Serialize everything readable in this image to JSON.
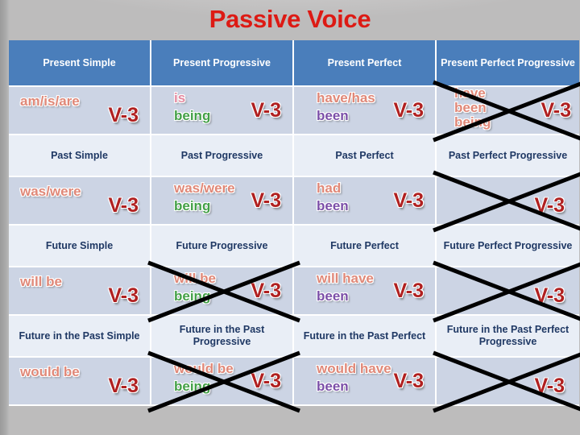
{
  "slide": {
    "title": "Passive Voice",
    "title_color": "#dd1a14",
    "header_bg": "#4a7ebb",
    "formula_row_bg": "#ccd4e4",
    "label_row_bg": "#e9eef6",
    "label_text_color": "#1f3864",
    "v3_color": "#b02020",
    "aux_salmon": "#e08878",
    "aux_pink": "#e58aa0",
    "aux_green": "#43a047",
    "aux_purple": "#7b4fa8"
  },
  "headers": [
    {
      "label": "Present Simple"
    },
    {
      "label": "Present Progressive"
    },
    {
      "label": "Present Perfect"
    },
    {
      "label": "Present Perfect Progressive"
    }
  ],
  "labels": {
    "past": [
      "Past Simple",
      "Past Progressive",
      "Past Perfect",
      "Past Perfect Progressive"
    ],
    "future": [
      "Future Simple",
      "Future Progressive",
      "Future Perfect",
      "Future Perfect Progressive"
    ],
    "future_in_past": [
      "Future in the Past Simple",
      "Future in the Past Progressive",
      "Future in the Past Perfect",
      "Future in the Past Perfect Progressive"
    ]
  },
  "formulas": {
    "present": [
      {
        "aux": [
          "am/is/are"
        ],
        "aux_colors": [
          "salmon"
        ],
        "v3": "V-3",
        "crossed": false
      },
      {
        "aux": [
          "is",
          "being"
        ],
        "aux_colors": [
          "pink",
          "green"
        ],
        "v3": "V-3",
        "crossed": false
      },
      {
        "aux": [
          "have/has",
          "been"
        ],
        "aux_colors": [
          "salmon",
          "purple"
        ],
        "v3": "V-3",
        "crossed": false
      },
      {
        "aux": [
          "have",
          "been",
          "being"
        ],
        "aux_colors": [
          "salmon",
          "salmon",
          "salmon"
        ],
        "v3": "V-3",
        "crossed": true
      }
    ],
    "past": [
      {
        "aux": [
          "was/were"
        ],
        "aux_colors": [
          "salmon"
        ],
        "v3": "V-3",
        "crossed": false
      },
      {
        "aux": [
          "was/were",
          "being"
        ],
        "aux_colors": [
          "salmon",
          "green"
        ],
        "v3": "V-3",
        "crossed": false
      },
      {
        "aux": [
          "had",
          "been"
        ],
        "aux_colors": [
          "salmon",
          "purple"
        ],
        "v3": "V-3",
        "crossed": false
      },
      {
        "aux": [],
        "aux_colors": [],
        "v3": "V-3",
        "crossed": true
      }
    ],
    "future": [
      {
        "aux": [
          "will be"
        ],
        "aux_colors": [
          "salmon"
        ],
        "v3": "V-3",
        "crossed": false
      },
      {
        "aux": [
          "will be",
          "being"
        ],
        "aux_colors": [
          "salmon",
          "green"
        ],
        "v3": "V-3",
        "crossed": true
      },
      {
        "aux": [
          "will have",
          "been"
        ],
        "aux_colors": [
          "salmon",
          "purple"
        ],
        "v3": "V-3",
        "crossed": false
      },
      {
        "aux": [],
        "aux_colors": [],
        "v3": "V-3",
        "crossed": true
      }
    ],
    "would": [
      {
        "aux": [
          "would be"
        ],
        "aux_colors": [
          "salmon"
        ],
        "v3": "V-3",
        "crossed": false
      },
      {
        "aux": [
          "would be",
          "being"
        ],
        "aux_colors": [
          "salmon",
          "green"
        ],
        "v3": "V-3",
        "crossed": true
      },
      {
        "aux": [
          "would have",
          "been"
        ],
        "aux_colors": [
          "salmon",
          "purple"
        ],
        "v3": "V-3",
        "crossed": false
      },
      {
        "aux": [],
        "aux_colors": [],
        "v3": "V-3",
        "crossed": true
      }
    ]
  }
}
